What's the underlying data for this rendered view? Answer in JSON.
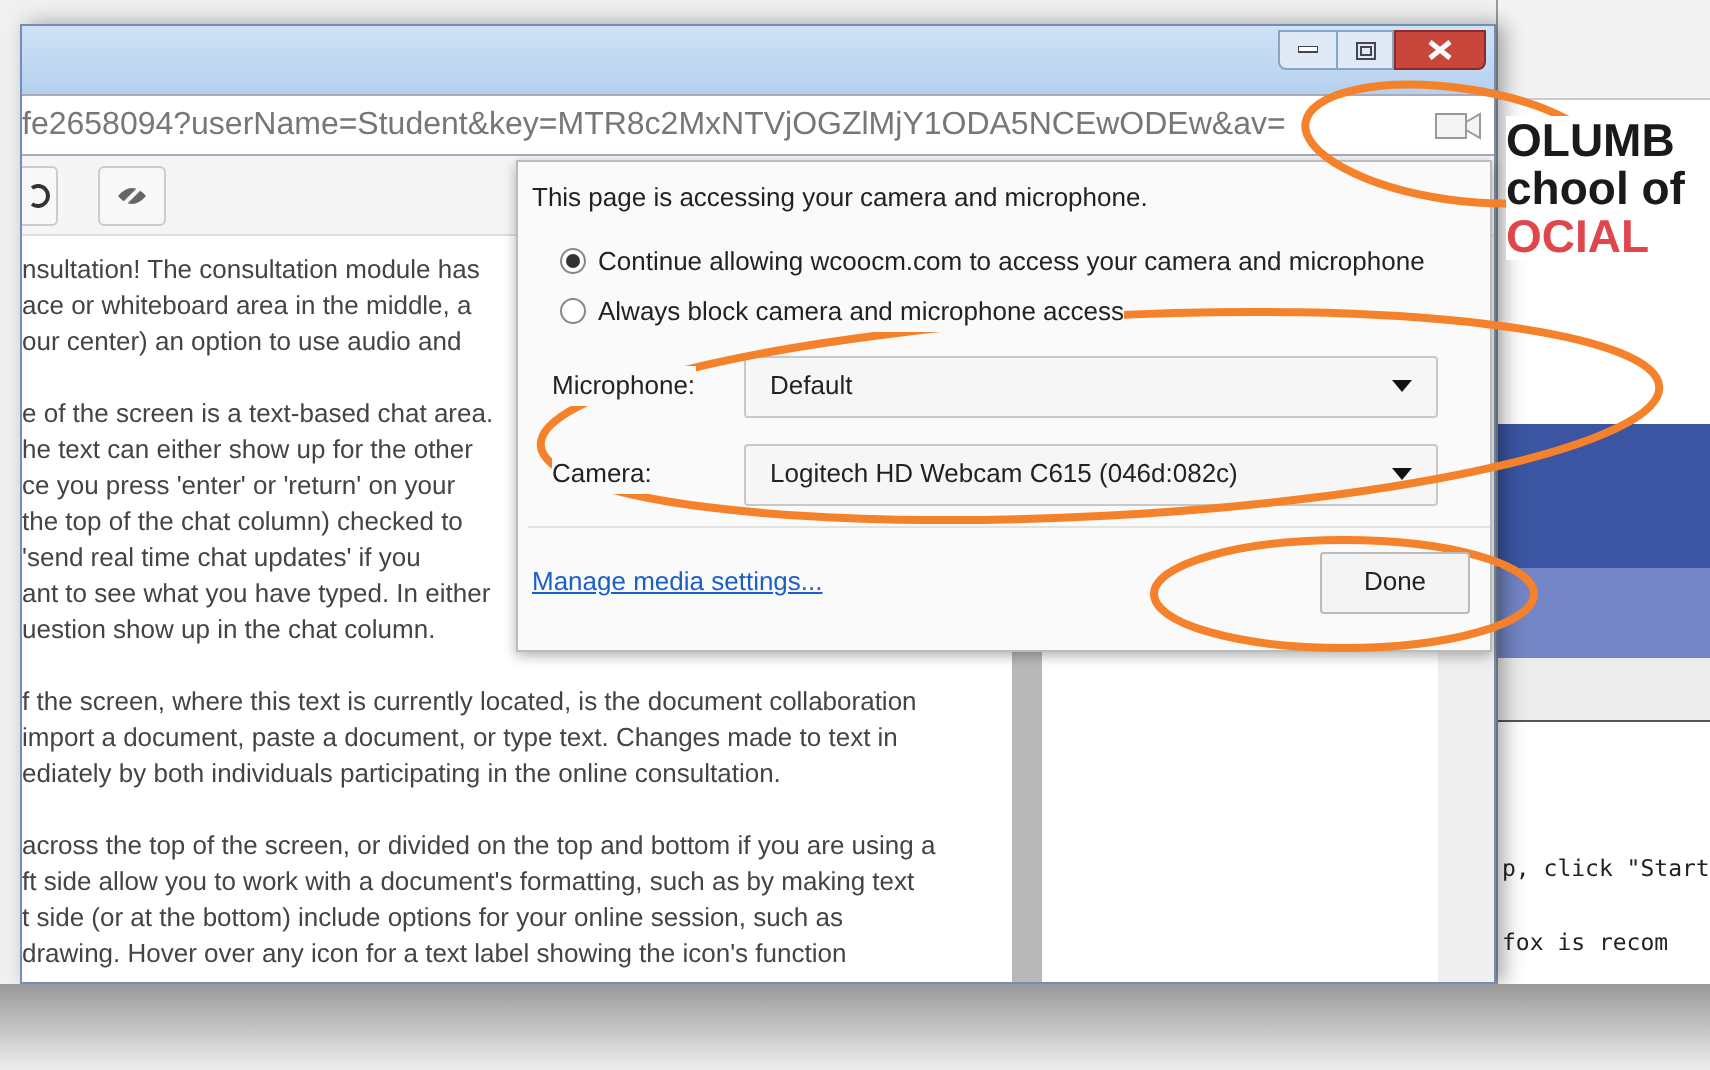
{
  "browser": {
    "address": "fe2658094?userName=Student&key=MTR8c2MxNTVjOGZlMjY1ODA5NCEwODEw&av="
  },
  "document": {
    "paragraphs": [
      [
        "nsultation! The consultation module has",
        "ace or whiteboard area in the middle, a",
        "our center) an option to use audio and"
      ],
      [
        "e of the screen is a text-based chat area.",
        "he text can either show up for the other",
        "ce you press 'enter' or 'return' on your",
        "the top of the chat column) checked to",
        "'send real time chat updates' if you",
        "ant to see what you have typed. In either",
        "uestion show up in the chat column."
      ],
      [
        "f the screen, where this text is currently located, is the document collaboration",
        "import a document, paste a document, or type text. Changes made to text in",
        "ediately by both individuals participating in the online consultation."
      ],
      [
        "across the top of the screen, or divided on the top and bottom if you are using a",
        "ft side allow you to work with a document's formatting, such as by making text",
        "t side (or at the bottom) include options for your online session, such as",
        "drawing. Hover over any icon for a text label showing the icon's function"
      ]
    ]
  },
  "permission_popup": {
    "message": "This page is accessing your camera and microphone.",
    "options": [
      {
        "label": "Continue allowing wcoocm.com to access your camera and microphone",
        "selected": true
      },
      {
        "label": "Always block camera and microphone access",
        "selected": false
      }
    ],
    "devices": [
      {
        "label": "Microphone:",
        "value": "Default"
      },
      {
        "label": "Camera:",
        "value": "Logitech HD Webcam C615 (046d:082c)"
      }
    ],
    "link": "Manage media settings...",
    "button": "Done"
  },
  "background_page": {
    "logo_lines": [
      {
        "text": "OLUMB",
        "color": "#1a1a1a"
      },
      {
        "text": "chool of",
        "color": "#1a1a1a"
      },
      {
        "text": "OCIAL",
        "color": "#e0474c"
      }
    ],
    "text_lines": [
      "p, click \"Start",
      "fox is recom"
    ]
  }
}
